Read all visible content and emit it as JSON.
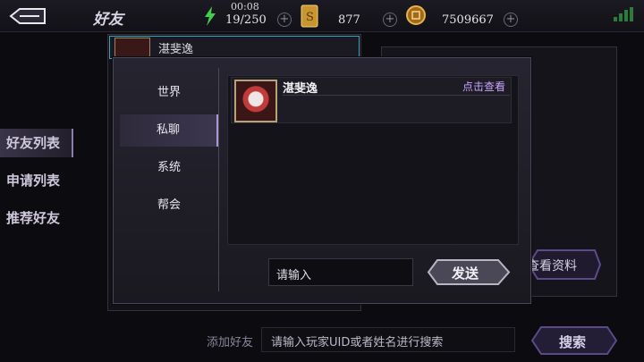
{
  "topbar": {
    "title": "好友",
    "clock": "00:08",
    "stamina": "19/250",
    "coin1": "877",
    "coin2": "7509667",
    "plus": "+"
  },
  "leftnav": {
    "items": [
      "好友列表",
      "申请列表",
      "推荐好友"
    ]
  },
  "friend_list": {
    "first_name": "湛斐逸"
  },
  "right_panel": {
    "view_profile": "查看资料"
  },
  "chat": {
    "tabs": [
      "世界",
      "私聊",
      "系统",
      "帮会"
    ],
    "active_tab": "私聊",
    "message": {
      "name": "湛斐逸",
      "view_link": "点击查看"
    },
    "input_placeholder": "请输入",
    "send_label": "发送"
  },
  "bottom": {
    "add_label": "添加好友",
    "search_placeholder": "请输入玩家UID或者姓名进行搜索",
    "search_button": "搜索"
  },
  "colors": {
    "accent": "#a89ad0",
    "link": "#c7a3ff",
    "stamina_icon": "#3fd04a",
    "coin_gold": "#d9a53a"
  },
  "icons": [
    "back-icon",
    "stamina-bolt-icon",
    "gold-card-icon",
    "coin-icon",
    "signal-icon"
  ]
}
